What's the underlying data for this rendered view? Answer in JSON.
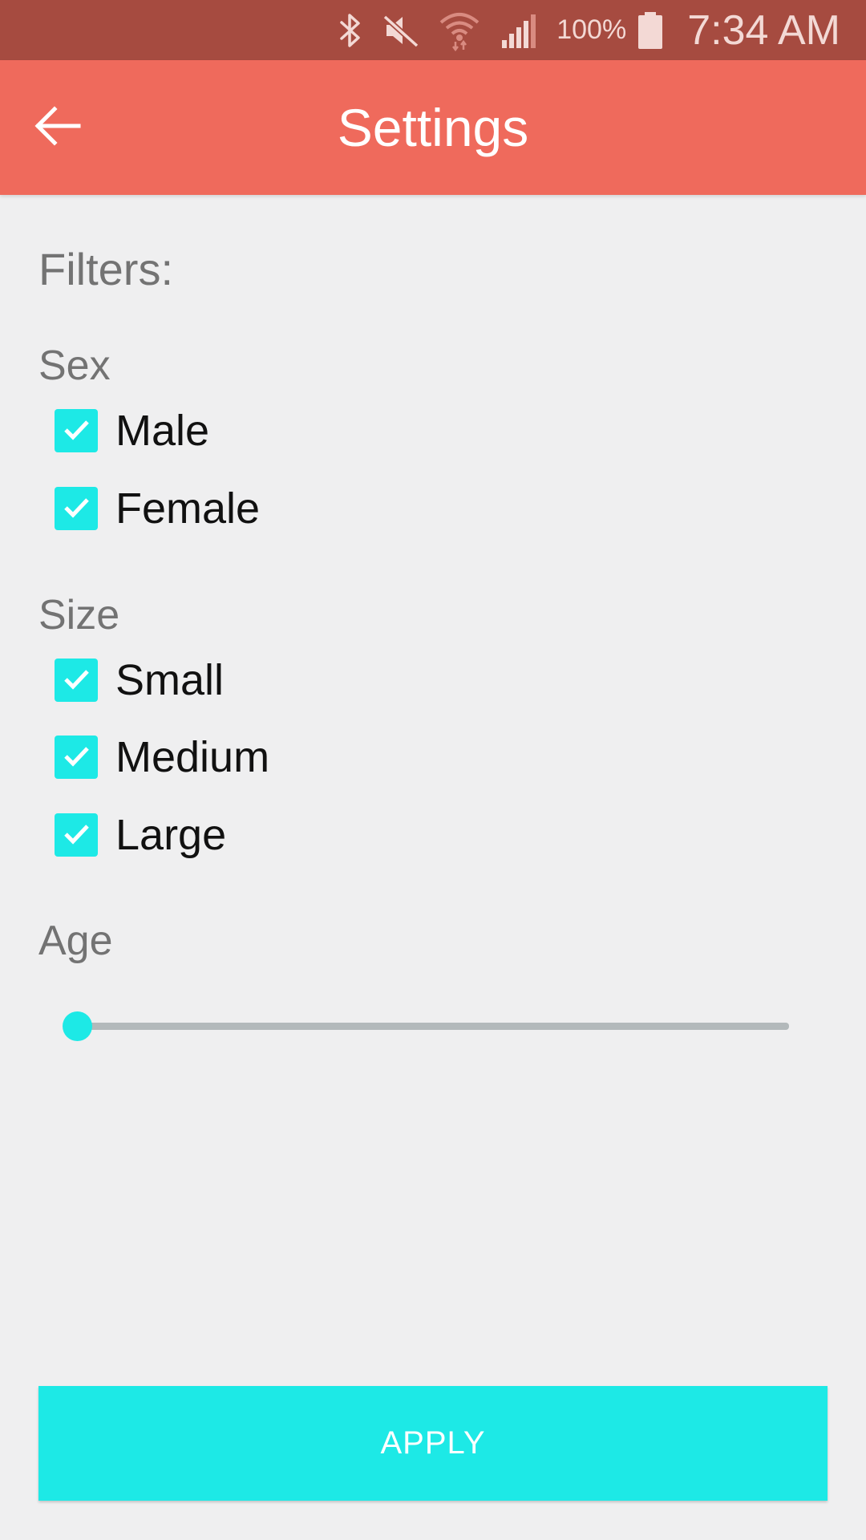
{
  "status_bar": {
    "battery": "100%",
    "time": "7:34 AM",
    "icons": [
      "bluetooth-icon",
      "mute-icon",
      "wifi-icon",
      "signal-icon",
      "battery-icon"
    ]
  },
  "app_bar": {
    "title": "Settings",
    "back_icon": "arrow-left-icon"
  },
  "filters": {
    "title": "Filters:",
    "sex": {
      "label": "Sex",
      "options": [
        {
          "label": "Male",
          "checked": true
        },
        {
          "label": "Female",
          "checked": true
        }
      ]
    },
    "size": {
      "label": "Size",
      "options": [
        {
          "label": "Small",
          "checked": true
        },
        {
          "label": "Medium",
          "checked": true
        },
        {
          "label": "Large",
          "checked": true
        }
      ]
    },
    "age": {
      "label": "Age",
      "slider_fraction": 0
    }
  },
  "apply_button": {
    "label": "APPLY"
  },
  "colors": {
    "status_bar": "#a64b40",
    "app_bar": "#ef6a5c",
    "accent": "#1de9e6",
    "background": "#efeff0",
    "section_text": "#737373"
  }
}
